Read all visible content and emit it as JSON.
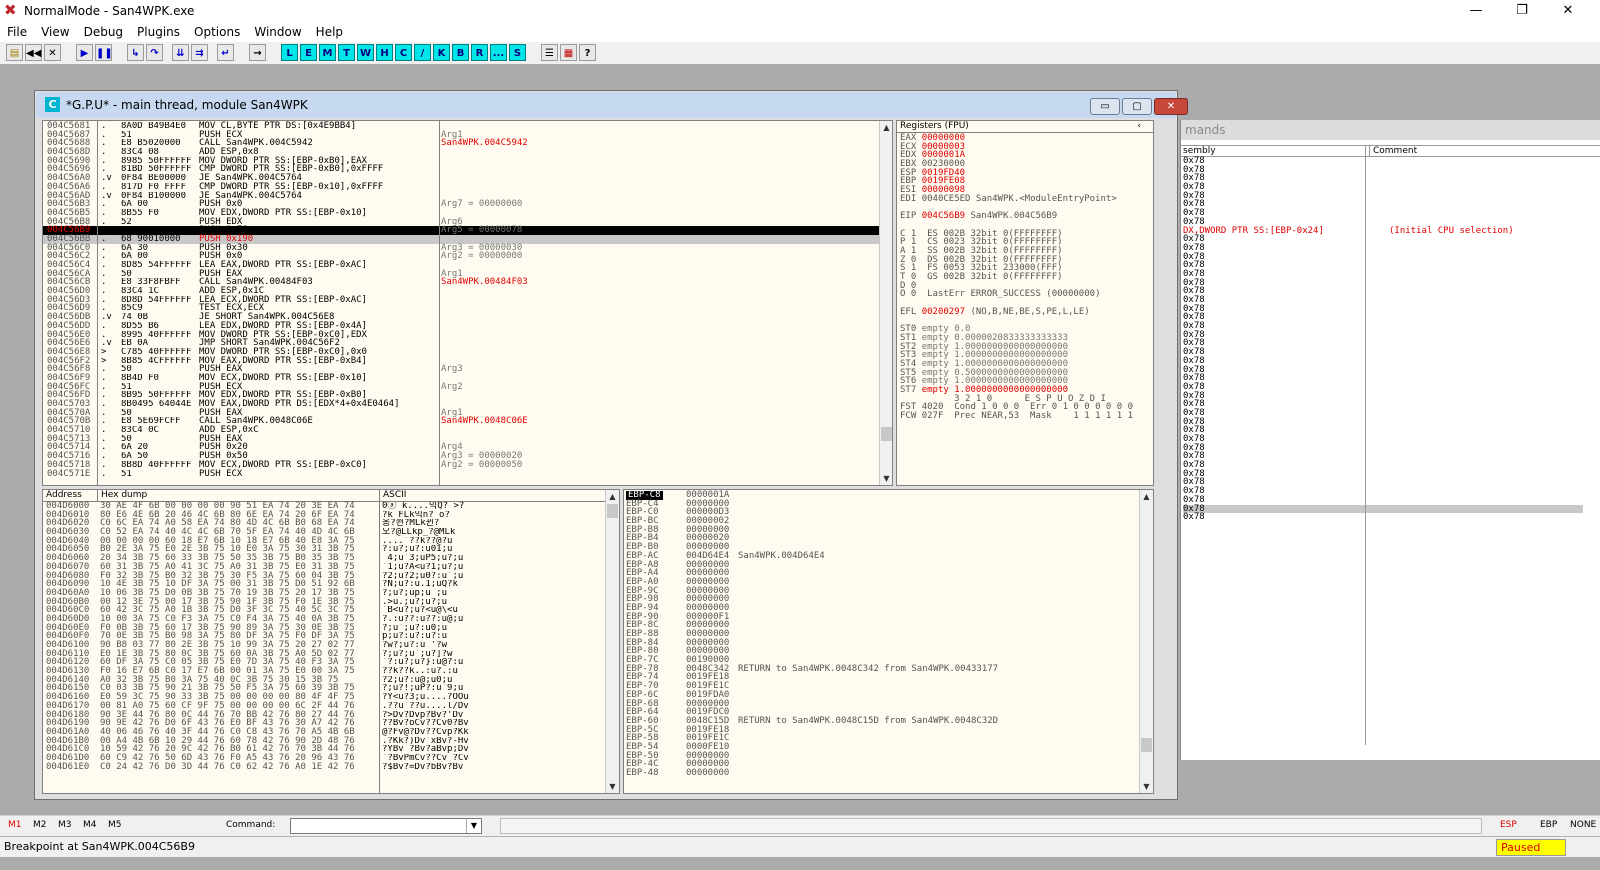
{
  "app": {
    "title": "NormalMode - San4WPK.exe"
  },
  "menu": [
    "File",
    "View",
    "Debug",
    "Plugins",
    "Options",
    "Window",
    "Help"
  ],
  "toolbar": {
    "buttons": [
      "L",
      "E",
      "M",
      "T",
      "W",
      "H",
      "C",
      "/",
      "K",
      "B",
      "R",
      "...",
      "S"
    ],
    "glyphs": {
      "minimize": "—",
      "restore": "❐",
      "close": "✕"
    }
  },
  "bgwin": {
    "title": "mands",
    "col_assembly": "sembly",
    "col_comment": "Comment",
    "lines": [
      "0x78",
      "0x78",
      "0x78",
      "0x78",
      "0x78",
      "0x78",
      "0x78",
      "0x78",
      "DX,DWORD PTR SS:[EBP-0x24]",
      "0x78",
      "0x78",
      "0x78",
      "0x78",
      "0x78",
      "0x78",
      "0x78",
      "0x78",
      "0x78",
      "0x78",
      "0x78",
      "0x78",
      "0x78",
      "0x78",
      "0x78",
      "0x78",
      "0x78",
      "0x78",
      "0x78",
      "0x78",
      "0x78",
      "0x78",
      "0x78",
      "0x78",
      "0x78",
      "0x78",
      "0x78",
      "0x78",
      "0x78",
      "0x78",
      "0x78",
      "0x78",
      "0x78"
    ],
    "comment": "(Initial CPU selection)"
  },
  "cpu": {
    "title": "*G.P.U* - main thread, module San4WPK",
    "icon": "C",
    "disasm": [
      [
        "004C5681",
        ".",
        "8A0D B49B4E0",
        "MOV CL,BYTE PTR DS:[0x4E9BB4]"
      ],
      [
        "004C5687",
        ".",
        "51",
        "PUSH ECX"
      ],
      [
        "004C5688",
        ".",
        "E8 B5020000",
        "CALL San4WPK.004C5942"
      ],
      [
        "004C568D",
        ".",
        "83C4 08",
        "ADD ESP,0x8"
      ],
      [
        "004C5690",
        ".",
        "8985 50FFFFFF",
        "MOV DWORD PTR SS:[EBP-0xB0],EAX"
      ],
      [
        "004C5696",
        ".",
        "81BD 50FFFFFF",
        "CMP DWORD PTR SS:[EBP-0xB0],0xFFFF"
      ],
      [
        "004C56A0",
        ".v",
        "0F84 BE00000",
        "JE San4WPK.004C5764"
      ],
      [
        "004C56A6",
        ".",
        "817D F0 FFFF",
        "CMP DWORD PTR SS:[EBP-0x10],0xFFFF"
      ],
      [
        "004C56AD",
        ".v",
        "0F84 B100000",
        "JE San4WPK.004C5764"
      ],
      [
        "004C56B3",
        ".",
        "6A 00",
        "PUSH 0x0"
      ],
      [
        "004C56B5",
        ".",
        "8B55 F0",
        "MOV EDX,DWORD PTR SS:[EBP-0x10]"
      ],
      [
        "004C56B8",
        ".",
        "52",
        "PUSH EDX"
      ],
      [
        "004C56B9",
        ".",
        "6A 78",
        "PUSH 0x78"
      ],
      [
        "004C56BB",
        ".",
        "68 90010000",
        "PUSH 0x190"
      ],
      [
        "004C56C0",
        ".",
        "6A 30",
        "PUSH 0x30"
      ],
      [
        "004C56C2",
        ".",
        "6A 00",
        "PUSH 0x0"
      ],
      [
        "004C56C4",
        ".",
        "8D85 54FFFFFF",
        "LEA EAX,DWORD PTR SS:[EBP-0xAC]"
      ],
      [
        "004C56CA",
        ".",
        "50",
        "PUSH EAX"
      ],
      [
        "004C56CB",
        ".",
        "E8 33F8FBFF",
        "CALL San4WPK.00484F03"
      ],
      [
        "004C56D0",
        ".",
        "83C4 1C",
        "ADD ESP,0x1C"
      ],
      [
        "004C56D3",
        ".",
        "8D8D 54FFFFFF",
        "LEA ECX,DWORD PTR SS:[EBP-0xAC]"
      ],
      [
        "004C56D9",
        ".",
        "85C9",
        "TEST ECX,ECX"
      ],
      [
        "004C56DB",
        ".v",
        "74 0B",
        "JE SHORT San4WPK.004C56E8"
      ],
      [
        "004C56DD",
        ".",
        "8D55 B6",
        "LEA EDX,DWORD PTR SS:[EBP-0x4A]"
      ],
      [
        "004C56E0",
        ".",
        "8995 40FFFFFF",
        "MOV DWORD PTR SS:[EBP-0xC0],EDX"
      ],
      [
        "004C56E6",
        ".v",
        "EB 0A",
        "JMP SHORT San4WPK.004C56F2"
      ],
      [
        "004C56E8",
        ">",
        "C785 40FFFFFF",
        "MOV DWORD PTR SS:[EBP-0xC0],0x0"
      ],
      [
        "004C56F2",
        ">",
        "8B85 4CFFFFFF",
        "MOV EAX,DWORD PTR SS:[EBP-0xB4]"
      ],
      [
        "004C56F8",
        ".",
        "50",
        "PUSH EAX"
      ],
      [
        "004C56F9",
        ".",
        "8B4D F0",
        "MOV ECX,DWORD PTR SS:[EBP-0x10]"
      ],
      [
        "004C56FC",
        ".",
        "51",
        "PUSH ECX"
      ],
      [
        "004C56FD",
        ".",
        "8B95 50FFFFFF",
        "MOV EDX,DWORD PTR SS:[EBP-0xB0]"
      ],
      [
        "004C5703",
        ".",
        "8B0495 64044E",
        "MOV EAX,DWORD PTR DS:[EDX*4+0x4E0464]"
      ],
      [
        "004C570A",
        ".",
        "50",
        "PUSH EAX"
      ],
      [
        "004C570B",
        ".",
        "E8 5E69FCFF",
        "CALL San4WPK.0048C06E"
      ],
      [
        "004C5710",
        ".",
        "83C4 0C",
        "ADD ESP,0xC"
      ],
      [
        "004C5713",
        ".",
        "50",
        "PUSH EAX"
      ],
      [
        "004C5714",
        ".",
        "6A 20",
        "PUSH 0x20"
      ],
      [
        "004C5716",
        ".",
        "6A 50",
        "PUSH 0x50"
      ],
      [
        "004C5718",
        ".",
        "8B8D 40FFFFFF",
        "MOV ECX,DWORD PTR SS:[EBP-0xC0]"
      ],
      [
        "004C571E",
        ".",
        "51",
        "PUSH ECX"
      ]
    ],
    "eip_addr": "004C56B9",
    "annotations": [
      {
        "row": 1,
        "text": "Arg1"
      },
      {
        "row": 2,
        "text": "San4WPK.004C5942",
        "red": true
      },
      {
        "row": 9,
        "text": "Arg7 = 00000000"
      },
      {
        "row": 11,
        "text": "Arg6"
      },
      {
        "row": 12,
        "text": "Arg5 = 00000078"
      },
      {
        "row": 14,
        "text": "Arg3 = 00000030"
      },
      {
        "row": 15,
        "text": "Arg2 = 00000000"
      },
      {
        "row": 17,
        "text": "Arg1"
      },
      {
        "row": 18,
        "text": "San4WPK.00484F03",
        "red": true
      },
      {
        "row": 28,
        "text": "Arg3"
      },
      {
        "row": 30,
        "text": "Arg2"
      },
      {
        "row": 33,
        "text": "Arg1"
      },
      {
        "row": 34,
        "text": "San4WPK.0048C06E",
        "red": true
      },
      {
        "row": 37,
        "text": "Arg4"
      },
      {
        "row": 38,
        "text": "Arg3 = 00000020"
      },
      {
        "row": 39,
        "text": "Arg2 = 00000050"
      },
      {
        "row": 41,
        "text": "Arg1"
      }
    ],
    "registers": {
      "header": "Registers (FPU)",
      "lines": [
        [
          "EAX ",
          "00000000",
          ""
        ],
        [
          "ECX ",
          "00000003",
          ""
        ],
        [
          "EDX ",
          "0000001A",
          ""
        ],
        [
          "EBX ",
          "00230000",
          "",
          true
        ],
        [
          "ESP ",
          "0019FD40",
          ""
        ],
        [
          "EBP ",
          "0019FE08",
          ""
        ],
        [
          "ESI ",
          "00000098",
          ""
        ],
        [
          "EDI ",
          "0040CE5ED",
          " San4WPK.<ModuleEntryPoint>",
          true
        ],
        [
          "",
          "",
          ""
        ],
        [
          "EIP ",
          "004C56B9",
          " San4WPK.004C56B9"
        ],
        [
          "",
          "",
          ""
        ],
        [
          "C 1  ",
          "ES 002B 32bit 0(FFFFFFFF)",
          ""
        ],
        [
          "P 1  ",
          "CS 0023 32bit 0(FFFFFFFF)",
          ""
        ],
        [
          "A 1  ",
          "SS 002B 32bit 0(FFFFFFFF)",
          ""
        ],
        [
          "Z 0  ",
          "DS 002B 32bit 0(FFFFFFFF)",
          ""
        ],
        [
          "S 1  ",
          "FS 0053 32bit 233000(FFF)",
          ""
        ],
        [
          "T 0  ",
          "GS 002B 32bit 0(FFFFFFFF)",
          ""
        ],
        [
          "D 0",
          "",
          ""
        ],
        [
          "O 0  ",
          "LastErr ERROR_SUCCESS (00000000)",
          ""
        ],
        [
          "",
          "",
          ""
        ],
        [
          "EFL ",
          "00200297",
          " (NO,B,NE,BE,S,PE,L,LE)"
        ],
        [
          "",
          "",
          ""
        ],
        [
          "ST0 ",
          "empty 0.0",
          ""
        ],
        [
          "ST1 ",
          "empty 0.0000020833333333333",
          ""
        ],
        [
          "ST2 ",
          "empty 1.0000000000000000000",
          ""
        ],
        [
          "ST3 ",
          "empty 1.0000000000000000000",
          ""
        ],
        [
          "ST4 ",
          "empty 1.0000000000000000000",
          ""
        ],
        [
          "ST5 ",
          "empty 0.5000000000000000000",
          ""
        ],
        [
          "ST6 ",
          "empty 1.0000000000000000000",
          ""
        ],
        [
          "ST7 ",
          "empty 1.0000000000000000000",
          ""
        ],
        [
          "",
          "          3 2 1 0      E S P U O Z D I",
          ""
        ],
        [
          "FST ",
          "4020  Cond 1 0 0 0  Err 0 1 0 0 0 0 0 0",
          ""
        ],
        [
          "FCW ",
          "027F  Prec NEAR,53  Mask    1 1 1 1 1 1",
          ""
        ]
      ]
    },
    "dump": {
      "col_address": "Address",
      "col_hex": "Hex dump",
      "col_ascii": "ASCII",
      "rows": [
        [
          "004D6000",
          "30 AE 4F 6B 00 00 00 00 90 51 EA 74 20 3E EA 74",
          "0ⓐ k....믹Q? >?"
        ],
        [
          "004D6010",
          "80 E6 4E 6B 20 46 4C 6B 80 6E EA 74 20 6F EA 74",
          "?k FLk믹n? o?"
        ],
        [
          "004D6020",
          "C0 6C EA 74 A0 58 EA 74 80 4D 4C 6B B0 68 EA 74",
          "옹?쬔?MLk뀐?"
        ],
        [
          "004D6030",
          "C0 52 EA 74 40 4C 4C 6B 70 5F EA 74 40 4D 4C 6B",
          "오?@LLkp_?@MLk"
        ],
        [
          "004D6040",
          "00 00 00 00 60 18 E7 6B 10 18 E7 6B 40 E8 3A 75",
          "....`??k??@?u"
        ],
        [
          "004D6050",
          "B0 2E 3A 75 E0 2E 3B 75 10 E0 3A 75 30 31 3B 75",
          "?:u?;u?:u01;u"
        ],
        [
          "004D6060",
          "20 34 3B 75 60 33 3B 75 50 35 3B 75 B0 35 3B 75",
          " 4;u`3;uP5;u?;u"
        ],
        [
          "004D6070",
          "60 31 3B 75 A0 41 3C 75 A0 31 3B 75 E0 31 3B 75",
          "`1;u?A<u?1;u?;u"
        ],
        [
          "004D6080",
          "F0 32 3B 75 B0 32 3B 75 30 F5 3A 75 60 04 3B 75",
          "?2;u?2;u0?:u`;u"
        ],
        [
          "004D6090",
          "10 4E 3B 75 10 DF 3A 75 00 31 3B 75 D0 51 92 6B",
          "?N;u?:u.1;uQ?k"
        ],
        [
          "004D60A0",
          "10 06 3B 75 D0 0B 3B 75 70 19 3B 75 20 17 3B 75",
          "?;u?;up;u ;u"
        ],
        [
          "004D60B0",
          "00 12 3E 75 00 17 3B 75 90 1F 3B 75 F0 1E 3B 75",
          ".>u.;u?;u?;u"
        ],
        [
          "004D60C0",
          "60 42 3C 75 A0 1B 3B 75 D0 3F 3C 75 40 5C 3C 75",
          "`B<u?;u?<u@\\<u"
        ],
        [
          "004D60D0",
          "10 00 3A 75 C0 F3 3A 75 C0 F4 3A 75 40 0A 3B 75",
          "?.:u??:u??:u@;u"
        ],
        [
          "004D60E0",
          "F0 0B 3B 75 60 17 3B 75 90 89 3A 75 30 0E 3B 75",
          "?;u`;u?:u0;u"
        ],
        [
          "004D60F0",
          "70 0E 3B 75 B0 98 3A 75 80 DF 3A 75 F0 DF 3A 75",
          "p;u?:u?:u?:u"
        ],
        [
          "004D6100",
          "90 B8 03 77 80 2E 3B 75 10 99 3A 75 20 27 02 77",
          "?w?;u?:u '?w"
        ],
        [
          "004D6110",
          "E0 1E 3B 75 80 0C 3B 75 60 0A 3B 75 A0 5D 02 77",
          "?;u?;u`;u?]?w"
        ],
        [
          "004D6120",
          "60 DF 3A 75 C0 05 3B 75 E0 7D 3A 75 40 F3 3A 75",
          "`?:u?;u?}:u@?:u"
        ],
        [
          "004D6130",
          "F0 16 E7 6B C0 17 E7 6B 00 01 3A 75 E0 00 3A 75",
          "??k??k..:u?.:u"
        ],
        [
          "004D6140",
          "A0 32 3B 75 B0 3A 75 40 0C 3B 75 30 15 3B 75",
          "?2;u?:u@;u0;u"
        ],
        [
          "004D6150",
          "C0 03 3B 75 90 21 3B 75 50 F5 3A 75 60 39 3B 75",
          "?;u?!;uP?:u`9;u"
        ],
        [
          "004D6160",
          "E0 59 3C 75 90 33 3B 75 00 00 00 00 80 4F 4F 75",
          "?Y<u?3;u....?OOu"
        ],
        [
          "004D6170",
          "00 81 A0 75 60 CF 9F 75 00 00 00 00 6C 2F 44 76",
          ".??u`??u....l/Dv"
        ],
        [
          "004D6180",
          "90 3E 44 76 80 0C 44 76 70 BB 42 76 80 27 44 76",
          "?>Dv?Dvp?Bv?'Dv"
        ],
        [
          "004D6190",
          "90 9E 42 76 D0 6F 43 76 E0 BF 43 76 30 A7 42 76",
          "??Bv?oCv??Cv0?Bv"
        ],
        [
          "004D61A0",
          "40 06 46 76 40 3F 44 76 C0 C8 43 76 70 A5 4B 6B",
          "@?Fv@?Dv??Cvp?Kk"
        ],
        [
          "004D61B0",
          "00 A4 4B 6B 10 29 44 76 60 78 42 76 90 2D 48 76",
          ".?Kk?)Dv`xBv?-Hv"
        ],
        [
          "004D61C0",
          "10 59 42 76 20 9C 42 76 B0 61 42 76 70 3B 44 76",
          "?YBv ?Bv?aBvp;Dv"
        ],
        [
          "004D61D0",
          "60 C9 42 76 50 6D 43 76 F0 A5 43 76 20 96 43 76",
          "`?BvPmCv??Cv ?Cv"
        ],
        [
          "004D61E0",
          "C0 24 42 76 D0 3D 44 76 C0 62 42 76 A0 1E 42 76",
          "?$Bv?=Dv?bBv?Bv"
        ]
      ]
    },
    "stack": {
      "label": "EBP-C8",
      "rows": [
        [
          "EBP-C8",
          "0000001A",
          ""
        ],
        [
          "EBP-C4",
          "00000000",
          ""
        ],
        [
          "EBP-C0",
          "000000D3",
          ""
        ],
        [
          "EBP-BC",
          "00000002",
          ""
        ],
        [
          "EBP-B8",
          "00000000",
          ""
        ],
        [
          "EBP-B4",
          "00000020",
          ""
        ],
        [
          "EBP-B0",
          "00000000",
          ""
        ],
        [
          "EBP-AC",
          "004D64E4",
          "San4WPK.004D64E4"
        ],
        [
          "EBP-A8",
          "00000000",
          ""
        ],
        [
          "EBP-A4",
          "00000000",
          ""
        ],
        [
          "EBP-A0",
          "00000000",
          ""
        ],
        [
          "EBP-9C",
          "00000000",
          ""
        ],
        [
          "EBP-98",
          "00000000",
          ""
        ],
        [
          "EBP-94",
          "00000000",
          ""
        ],
        [
          "EBP-90",
          "000000F1",
          ""
        ],
        [
          "EBP-8C",
          "00000000",
          ""
        ],
        [
          "EBP-88",
          "00000000",
          ""
        ],
        [
          "EBP-84",
          "00000000",
          ""
        ],
        [
          "EBP-80",
          "00000000",
          ""
        ],
        [
          "EBP-7C",
          "00190000",
          ""
        ],
        [
          "EBP-78",
          "0048C342",
          "RETURN to San4WPK.0048C342 from San4WPK.00433177"
        ],
        [
          "EBP-74",
          "0019FE18",
          ""
        ],
        [
          "EBP-70",
          "0019FE1C",
          ""
        ],
        [
          "EBP-6C",
          "0019FDA0",
          ""
        ],
        [
          "EBP-68",
          "00000000",
          ""
        ],
        [
          "EBP-64",
          "0019FDC0",
          ""
        ],
        [
          "EBP-60",
          "0048C15D",
          "RETURN to San4WPK.0048C15D from San4WPK.0048C32D"
        ],
        [
          "EBP-5C",
          "0019FE18",
          ""
        ],
        [
          "EBP-58",
          "0019FE1C",
          ""
        ],
        [
          "EBP-54",
          "0000FE10",
          ""
        ],
        [
          "EBP-50",
          "00000000",
          ""
        ],
        [
          "EBP-4C",
          "00000000",
          ""
        ],
        [
          "EBP-48",
          "00000000",
          ""
        ]
      ]
    }
  },
  "commandbar": {
    "m": [
      "M1",
      "M2",
      "M3",
      "M4",
      "M5"
    ],
    "label": "Command:",
    "esp": "ESP",
    "ebp": "EBP",
    "none": "NONE"
  },
  "status": {
    "text": "Breakpoint at San4WPK.004C56B9",
    "state": "Paused"
  }
}
